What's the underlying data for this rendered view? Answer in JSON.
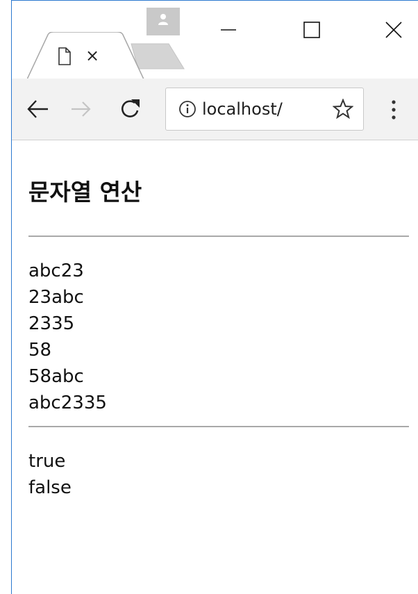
{
  "browser": {
    "tab_close_label": "×",
    "url": "localhost/",
    "icons": {
      "profile": "profile-icon",
      "minimize": "minimize-icon",
      "maximize": "maximize-icon",
      "close": "close-icon",
      "page": "page-icon",
      "back": "back-arrow-icon",
      "forward": "forward-arrow-icon",
      "reload": "reload-icon",
      "info": "info-icon",
      "star": "star-icon",
      "menu": "kebab-menu-icon"
    }
  },
  "page": {
    "title": "문자열 연산",
    "block1": [
      "abc23",
      "23abc",
      "2335",
      "58",
      "58abc",
      "abc2335"
    ],
    "block2": [
      "true",
      "false"
    ]
  }
}
